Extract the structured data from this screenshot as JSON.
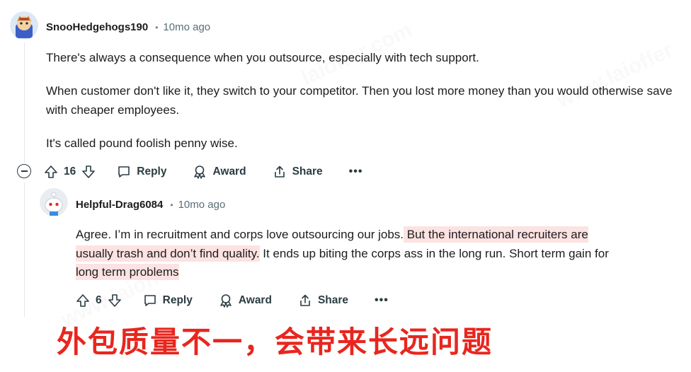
{
  "comment1": {
    "username": "SnooHedgehogs190",
    "time": "10mo ago",
    "paragraphs": [
      "There's always a consequence when you outsource, especially with tech support.",
      "When customer don't like it, they switch to your competitor. Then you lost more money than you would otherwise save with cheaper employees.",
      "It's called pound foolish penny wise."
    ],
    "votes": "16",
    "reply_label": "Reply",
    "award_label": "Award",
    "share_label": "Share",
    "more_label": "•••"
  },
  "comment2": {
    "username": "Helpful-Drag6084",
    "time": "10mo ago",
    "text_part1": "Agree. I’m in recruitment and corps love outsourcing our jobs.",
    "text_highlight_line1": " But the international recruiters are",
    "text_highlight_line2": "usually trash and don’t find quality.",
    "text_part2_line2": " It ends up biting the corps ass in the long run. Short term gain for",
    "text_highlight_line3": "long term problems",
    "votes": "6",
    "reply_label": "Reply",
    "award_label": "Award",
    "share_label": "Share",
    "more_label": "•••"
  },
  "caption": "外包质量不一，会带来长远问题",
  "colors": {
    "highlight": "#fde2e2",
    "caption": "#e8261e",
    "text": "#1c1c1c",
    "meta": "#576f76"
  }
}
